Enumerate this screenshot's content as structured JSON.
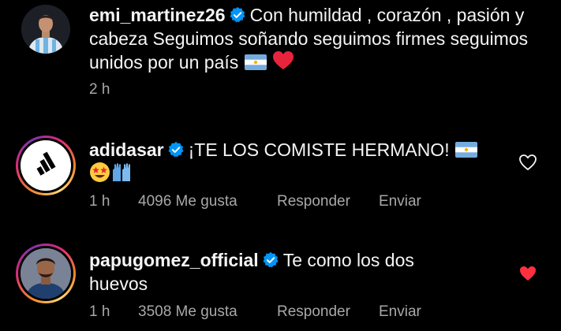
{
  "caption": {
    "username": "emi_martinez26",
    "text": "Con humildad , corazón , pasión y cabeza  Seguimos soñando seguimos firmes seguimos unidos por un país",
    "emojis": [
      "argentina-flag",
      "red-heart"
    ],
    "time": "2 h"
  },
  "comments": [
    {
      "username": "adidasar",
      "text": "¡TE LOS COMISTE HERMANO!",
      "emojis": [
        "argentina-flag",
        "star-struck-face",
        "gloves"
      ],
      "time": "1 h",
      "likes": "4096 Me gusta",
      "reply_label": "Responder",
      "send_label": "Enviar",
      "liked": false
    },
    {
      "username": "papugomez_official",
      "text": "Te como los dos huevos",
      "time": "1 h",
      "likes": "3508 Me gusta",
      "reply_label": "Responder",
      "send_label": "Enviar",
      "liked": true
    }
  ],
  "colors": {
    "background": "#000000",
    "text": "#f5f5f5",
    "secondary": "#a8a8a8",
    "verified": "#0095f6",
    "liked_heart": "#ff3040"
  }
}
